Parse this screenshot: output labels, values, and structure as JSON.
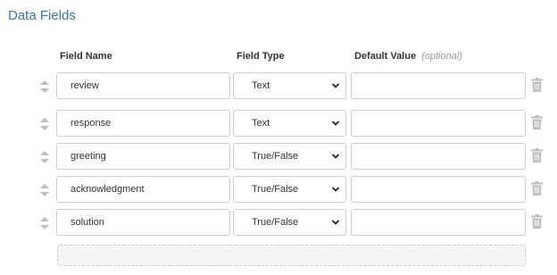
{
  "title": "Data Fields",
  "headers": {
    "field_name": "Field Name",
    "field_type": "Field Type",
    "default_value": "Default Value",
    "optional": "(optional)"
  },
  "rows": [
    {
      "name": "review",
      "type": "Text",
      "default": ""
    },
    {
      "name": "response",
      "type": "Text",
      "default": ""
    },
    {
      "name": "greeting",
      "type": "True/False",
      "default": ""
    },
    {
      "name": "acknowledgment",
      "type": "True/False",
      "default": ""
    },
    {
      "name": "solution",
      "type": "True/False",
      "default": ""
    }
  ],
  "icons": {
    "drag": "drag-handle-icon",
    "select": "chevron-down-icon",
    "delete": "trash-icon"
  },
  "colors": {
    "title": "#3a72b5",
    "border": "#cfcfcf",
    "icon": "#bdbdbd"
  }
}
